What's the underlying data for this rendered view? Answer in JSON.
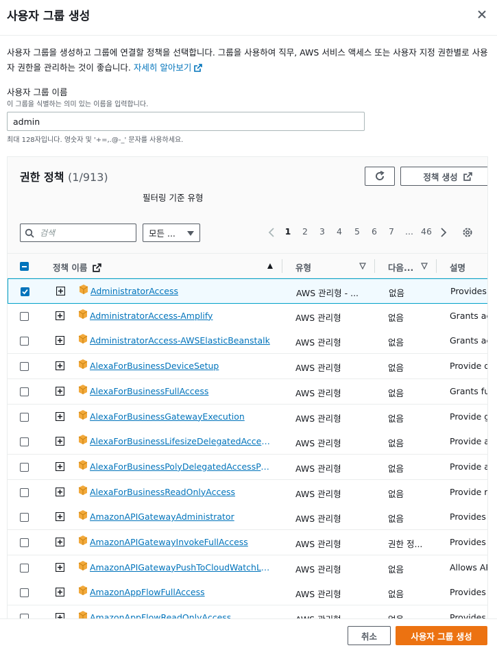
{
  "dialog": {
    "title": "사용자 그룹 생성",
    "description": "사용자 그룹을 생성하고 그룹에 연결할 정책을 선택합니다. 그룹을 사용하여 직무, AWS 서비스 액세스 또는 사용자 지정 권한별로 사용자 권한을 관리하는 것이 좋습니다.",
    "learn_more": "자세히 알아보기"
  },
  "group_name": {
    "label": "사용자 그룹 이름",
    "hint": "이 그룹을 식별하는 의미 있는 이름을 입력합니다.",
    "value": "admin",
    "constraint": "최대 128자입니다. 영숫자 및 '+=,.@-_' 문자를 사용하세요."
  },
  "policies": {
    "title": "권한 정책",
    "count": "(1/913)",
    "refresh_icon": "refresh-icon",
    "create_label": "정책 생성",
    "filter_type_label": "필터링 기준 유형",
    "search_placeholder": "검색",
    "filter_value": "모든 ...",
    "pages": [
      "1",
      "2",
      "3",
      "4",
      "5",
      "6",
      "7",
      "...",
      "46"
    ],
    "columns": {
      "name": "정책 이름",
      "type": "유형",
      "next": "다음...",
      "desc": "설명"
    },
    "rows": [
      {
        "name": "AdministratorAccess",
        "type": "AWS 관리형 - ...",
        "next": "없음",
        "desc": "Provides fu",
        "selected": true
      },
      {
        "name": "AdministratorAccess-Amplify",
        "type": "AWS 관리형",
        "next": "없음",
        "desc": "Grants acc",
        "selected": false
      },
      {
        "name": "AdministratorAccess-AWSElasticBeanstalk",
        "type": "AWS 관리형",
        "next": "없음",
        "desc": "Grants acc",
        "selected": false
      },
      {
        "name": "AlexaForBusinessDeviceSetup",
        "type": "AWS 관리형",
        "next": "없음",
        "desc": "Provide de",
        "selected": false
      },
      {
        "name": "AlexaForBusinessFullAccess",
        "type": "AWS 관리형",
        "next": "없음",
        "desc": "Grants full",
        "selected": false
      },
      {
        "name": "AlexaForBusinessGatewayExecution",
        "type": "AWS 관리형",
        "next": "없음",
        "desc": "Provide ga",
        "selected": false
      },
      {
        "name": "AlexaForBusinessLifesizeDelegatedAccessPo...",
        "type": "AWS 관리형",
        "next": "없음",
        "desc": "Provide ac",
        "selected": false
      },
      {
        "name": "AlexaForBusinessPolyDelegatedAccessPolicy",
        "type": "AWS 관리형",
        "next": "없음",
        "desc": "Provide ac",
        "selected": false
      },
      {
        "name": "AlexaForBusinessReadOnlyAccess",
        "type": "AWS 관리형",
        "next": "없음",
        "desc": "Provide re",
        "selected": false
      },
      {
        "name": "AmazonAPIGatewayAdministrator",
        "type": "AWS 관리형",
        "next": "없음",
        "desc": "Provides fu",
        "selected": false
      },
      {
        "name": "AmazonAPIGatewayInvokeFullAccess",
        "type": "AWS 관리형",
        "next": "권한 정...",
        "desc": "Provides fu",
        "selected": false
      },
      {
        "name": "AmazonAPIGatewayPushToCloudWatchLogs",
        "type": "AWS 관리형",
        "next": "없음",
        "desc": "Allows API",
        "selected": false
      },
      {
        "name": "AmazonAppFlowFullAccess",
        "type": "AWS 관리형",
        "next": "없음",
        "desc": "Provides fu",
        "selected": false
      },
      {
        "name": "AmazonAppFlowReadOnlyAccess",
        "type": "AWS 관리형",
        "next": "없음",
        "desc": "Provides re",
        "selected": false
      }
    ]
  },
  "footer": {
    "cancel_label": "취소",
    "submit_label": "사용자 그룹 생성"
  },
  "colors": {
    "accent": "#ec7211",
    "link": "#0073bb"
  }
}
